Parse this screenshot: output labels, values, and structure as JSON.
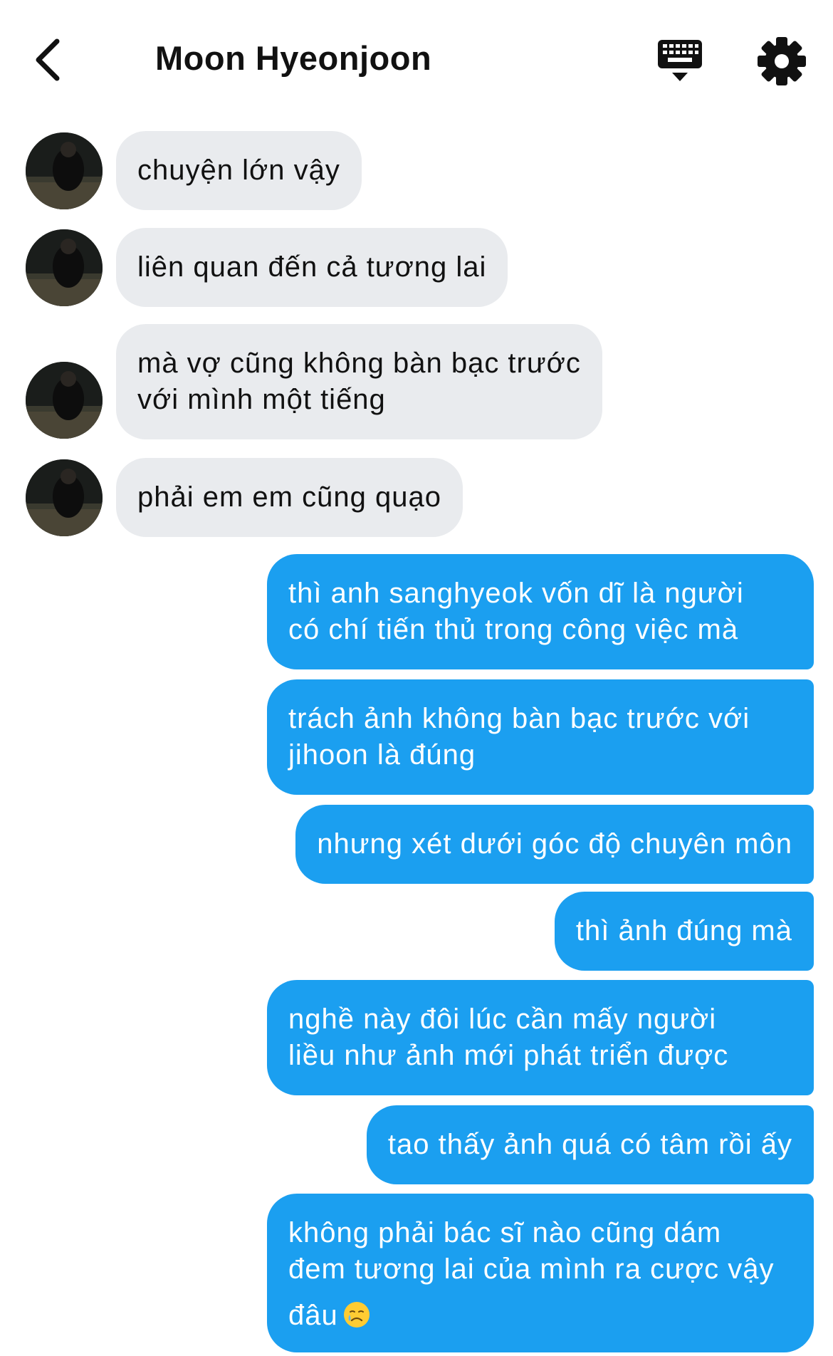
{
  "header": {
    "contact_name": "Moon Hyeonjoon",
    "back_icon": "chevron-left-icon",
    "keyboard_icon": "keyboard-icon",
    "settings_icon": "gear-icon"
  },
  "colors": {
    "incoming_bubble": "#e9ebee",
    "outgoing_bubble": "#1b9ff0"
  },
  "messages": [
    {
      "direction": "incoming",
      "lines": [
        "chuyện lớn vậy"
      ]
    },
    {
      "direction": "incoming",
      "lines": [
        "liên quan đến cả tương lai"
      ]
    },
    {
      "direction": "incoming",
      "lines": [
        "mà vợ cũng không bàn bạc trước",
        "với mình một tiếng"
      ]
    },
    {
      "direction": "incoming",
      "lines": [
        "phải em em cũng quạo"
      ]
    },
    {
      "direction": "outgoing",
      "lines": [
        "thì anh sanghyeok vốn dĩ là người",
        "có chí tiến thủ trong công việc mà"
      ]
    },
    {
      "direction": "outgoing",
      "lines": [
        "trách ảnh không bàn bạc trước với",
        "jihoon là đúng"
      ]
    },
    {
      "direction": "outgoing",
      "lines": [
        "nhưng xét dưới góc độ chuyên môn"
      ]
    },
    {
      "direction": "outgoing",
      "lines": [
        "thì ảnh đúng mà"
      ]
    },
    {
      "direction": "outgoing",
      "lines": [
        "nghề này đôi lúc cần mấy người",
        "liều như ảnh mới phát triển được"
      ]
    },
    {
      "direction": "outgoing",
      "lines": [
        "tao thấy ảnh quá có tâm rồi ấy"
      ]
    },
    {
      "direction": "outgoing",
      "lines": [
        "không phải bác sĩ nào cũng dám",
        "đem tương lai của mình ra cược vậy",
        "đâu"
      ],
      "emoji": "crying-face-emoji"
    }
  ]
}
